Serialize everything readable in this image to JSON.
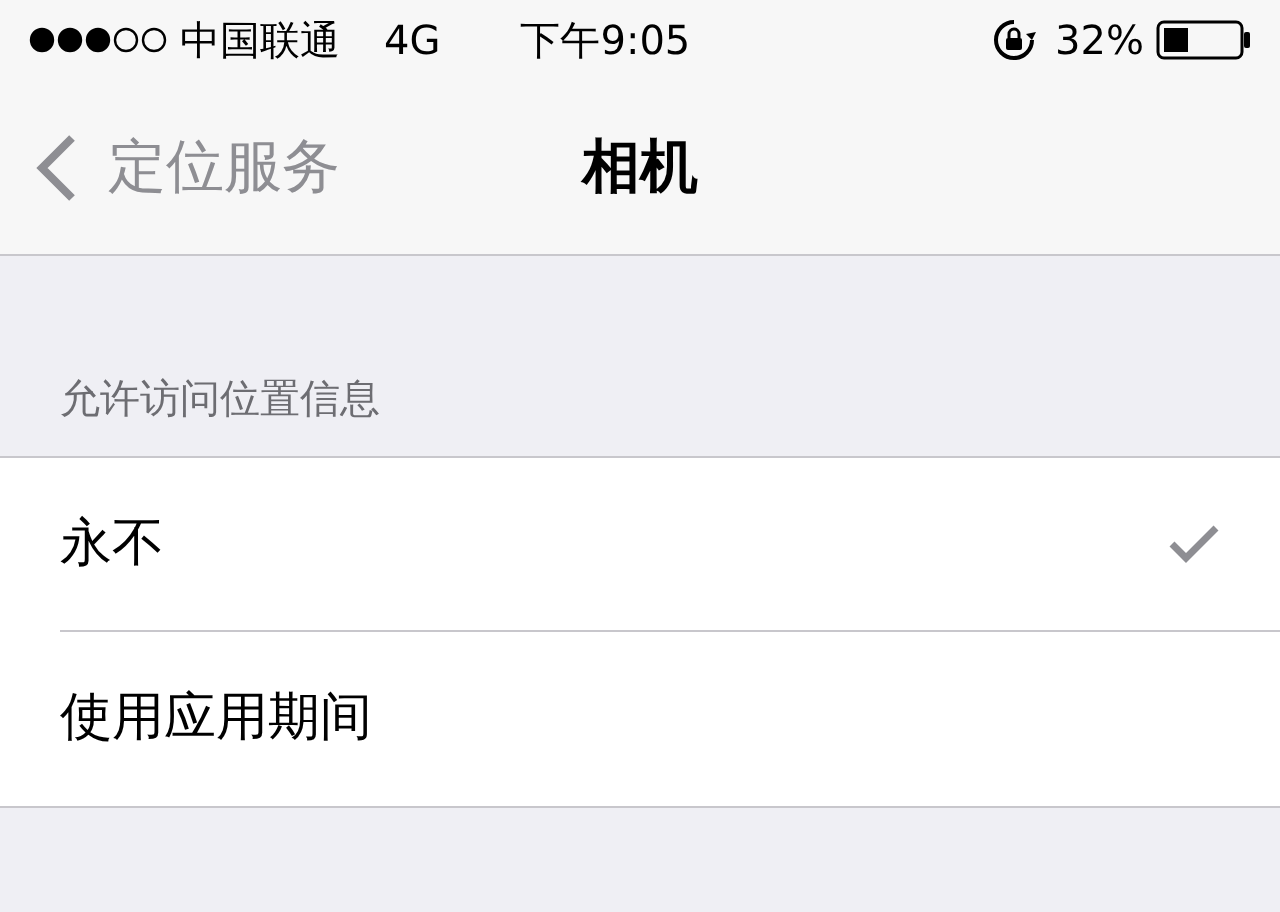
{
  "status_bar": {
    "carrier": "中国联通",
    "network": "4G",
    "time": "下午9:05",
    "battery_percent": "32%"
  },
  "nav_bar": {
    "back_label": "定位服务",
    "title": "相机"
  },
  "section": {
    "header": "允许访问位置信息",
    "options": [
      {
        "label": "永不",
        "selected": true
      },
      {
        "label": "使用应用期间",
        "selected": false
      }
    ]
  }
}
